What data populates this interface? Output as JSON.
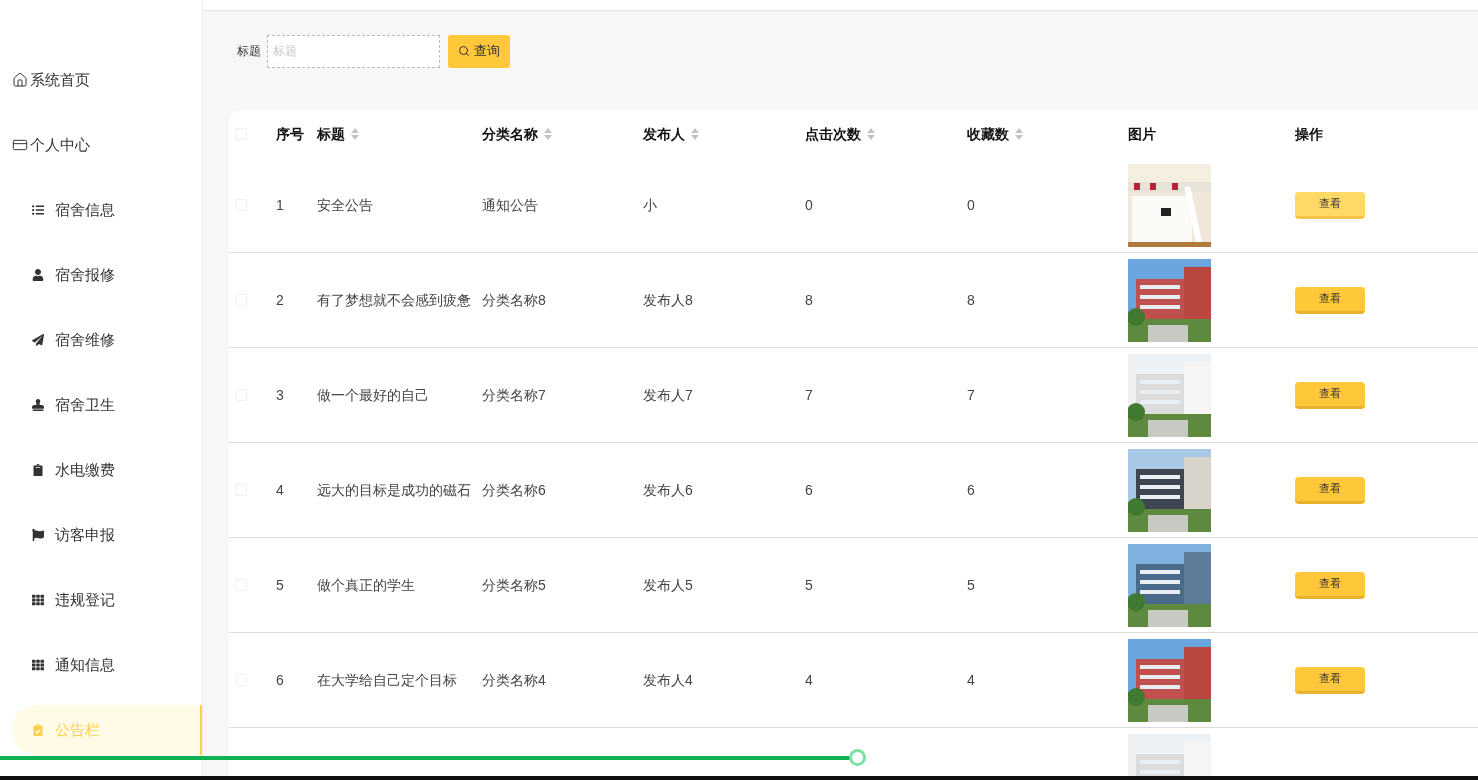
{
  "sidebar": {
    "items": [
      {
        "label": "系统首页",
        "kind": "top",
        "selected": false
      },
      {
        "label": "个人中心",
        "kind": "top",
        "selected": false
      },
      {
        "label": "宿舍信息",
        "kind": "sub",
        "selected": false
      },
      {
        "label": "宿舍报修",
        "kind": "sub",
        "selected": false
      },
      {
        "label": "宿舍维修",
        "kind": "sub",
        "selected": false
      },
      {
        "label": "宿舍卫生",
        "kind": "sub",
        "selected": false
      },
      {
        "label": "水电缴费",
        "kind": "sub",
        "selected": false
      },
      {
        "label": "访客申报",
        "kind": "sub",
        "selected": false
      },
      {
        "label": "违规登记",
        "kind": "sub",
        "selected": false
      },
      {
        "label": "通知信息",
        "kind": "sub",
        "selected": false
      },
      {
        "label": "公告栏",
        "kind": "sub",
        "selected": true
      }
    ]
  },
  "select_all": {
    "checked": false
  },
  "search": {
    "label": "标题",
    "placeholder": "标题",
    "button": "查询"
  },
  "table": {
    "columns": [
      {
        "label": "序号",
        "sortable": false
      },
      {
        "label": "标题",
        "sortable": true
      },
      {
        "label": "分类名称",
        "sortable": true
      },
      {
        "label": "发布人",
        "sortable": true
      },
      {
        "label": "点击次数",
        "sortable": true
      },
      {
        "label": "收藏数",
        "sortable": true
      },
      {
        "label": "图片",
        "sortable": false
      },
      {
        "label": "操作",
        "sortable": false
      }
    ],
    "rows": [
      {
        "index": "1",
        "title": "安全公告",
        "category": "通知公告",
        "publisher": "小",
        "clicks": "0",
        "favorites": "0",
        "picture": {
          "kind": "picture"
        },
        "action": "查看",
        "hovered": true,
        "checked": false
      },
      {
        "index": "2",
        "title": "有了梦想就不会感到疲惫",
        "category": "分类名称8",
        "publisher": "发布人8",
        "clicks": "8",
        "favorites": "8",
        "picture": {
          "kind": "picture"
        },
        "action": "查看",
        "hovered": false,
        "checked": false
      },
      {
        "index": "3",
        "title": "做一个最好的自己",
        "category": "分类名称7",
        "publisher": "发布人7",
        "clicks": "7",
        "favorites": "7",
        "picture": {
          "kind": "picture"
        },
        "action": "查看",
        "hovered": false,
        "checked": false
      },
      {
        "index": "4",
        "title": "远大的目标是成功的磁石",
        "category": "分类名称6",
        "publisher": "发布人6",
        "clicks": "6",
        "favorites": "6",
        "picture": {
          "kind": "picture"
        },
        "action": "查看",
        "hovered": false,
        "checked": false
      },
      {
        "index": "5",
        "title": "做个真正的学生",
        "category": "分类名称5",
        "publisher": "发布人5",
        "clicks": "5",
        "favorites": "5",
        "picture": {
          "kind": "picture"
        },
        "action": "查看",
        "hovered": false,
        "checked": false
      },
      {
        "index": "6",
        "title": "在大学给自己定个目标",
        "category": "分类名称4",
        "publisher": "发布人4",
        "clicks": "4",
        "favorites": "4",
        "picture": {
          "kind": "picture"
        },
        "action": "查看",
        "hovered": false,
        "checked": false
      },
      {
        "picture": {
          "kind": "picture"
        }
      }
    ]
  },
  "player": {
    "level": 0.58
  }
}
